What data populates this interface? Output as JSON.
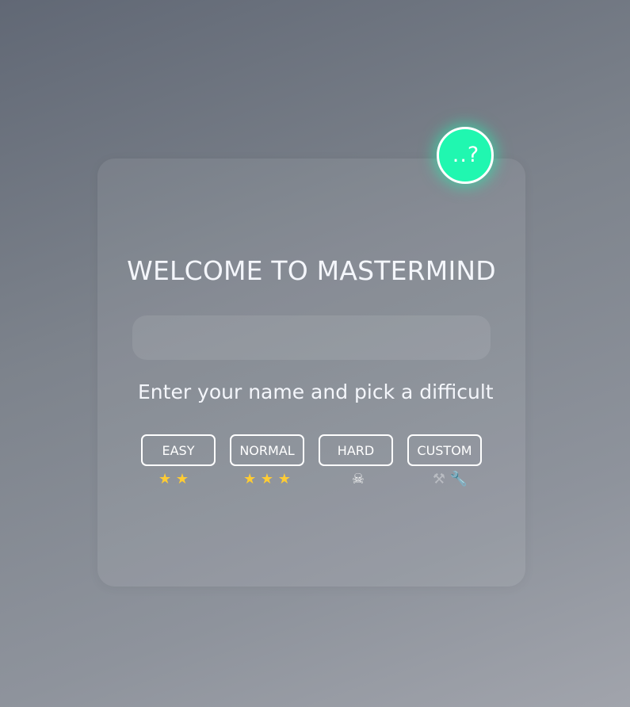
{
  "help_button": {
    "label": "..?"
  },
  "welcome": {
    "title": "WELCOME TO MASTERMIND"
  },
  "name_input": {
    "value": "",
    "placeholder": ""
  },
  "instruction": "Enter your name and pick a difficult",
  "difficulties": [
    {
      "label": "EASY",
      "rating": "★ ★",
      "rating_icon": "star-icon"
    },
    {
      "label": "NORMAL",
      "rating": "★ ★ ★",
      "rating_icon": "star-icon"
    },
    {
      "label": "HARD",
      "rating": "☠",
      "rating_icon": "skull-icon"
    },
    {
      "label": "CUSTOM",
      "rating": "⚒ 🔧",
      "rating_icon": "tools-icon"
    }
  ],
  "colors": {
    "accent": "#20f7b0",
    "star": "#ffcc33",
    "text": "#f4f6fb"
  }
}
